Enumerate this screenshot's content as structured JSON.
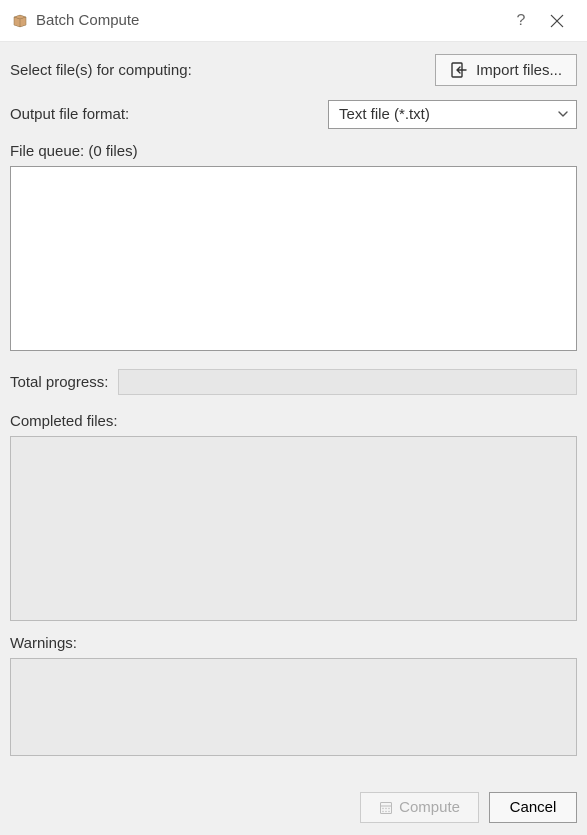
{
  "window": {
    "title": "Batch Compute"
  },
  "labels": {
    "select_files": "Select file(s) for computing:",
    "output_format": "Output file format:",
    "file_queue": "File queue: (0 files)",
    "total_progress": "Total progress:",
    "completed_files": "Completed files:",
    "warnings": "Warnings:"
  },
  "buttons": {
    "import_files": "Import files...",
    "compute": "Compute",
    "cancel": "Cancel"
  },
  "output_format": {
    "selected": "Text file (*.txt)"
  },
  "compute_enabled": false,
  "file_queue_items": [],
  "completed_items": [],
  "warnings_items": []
}
